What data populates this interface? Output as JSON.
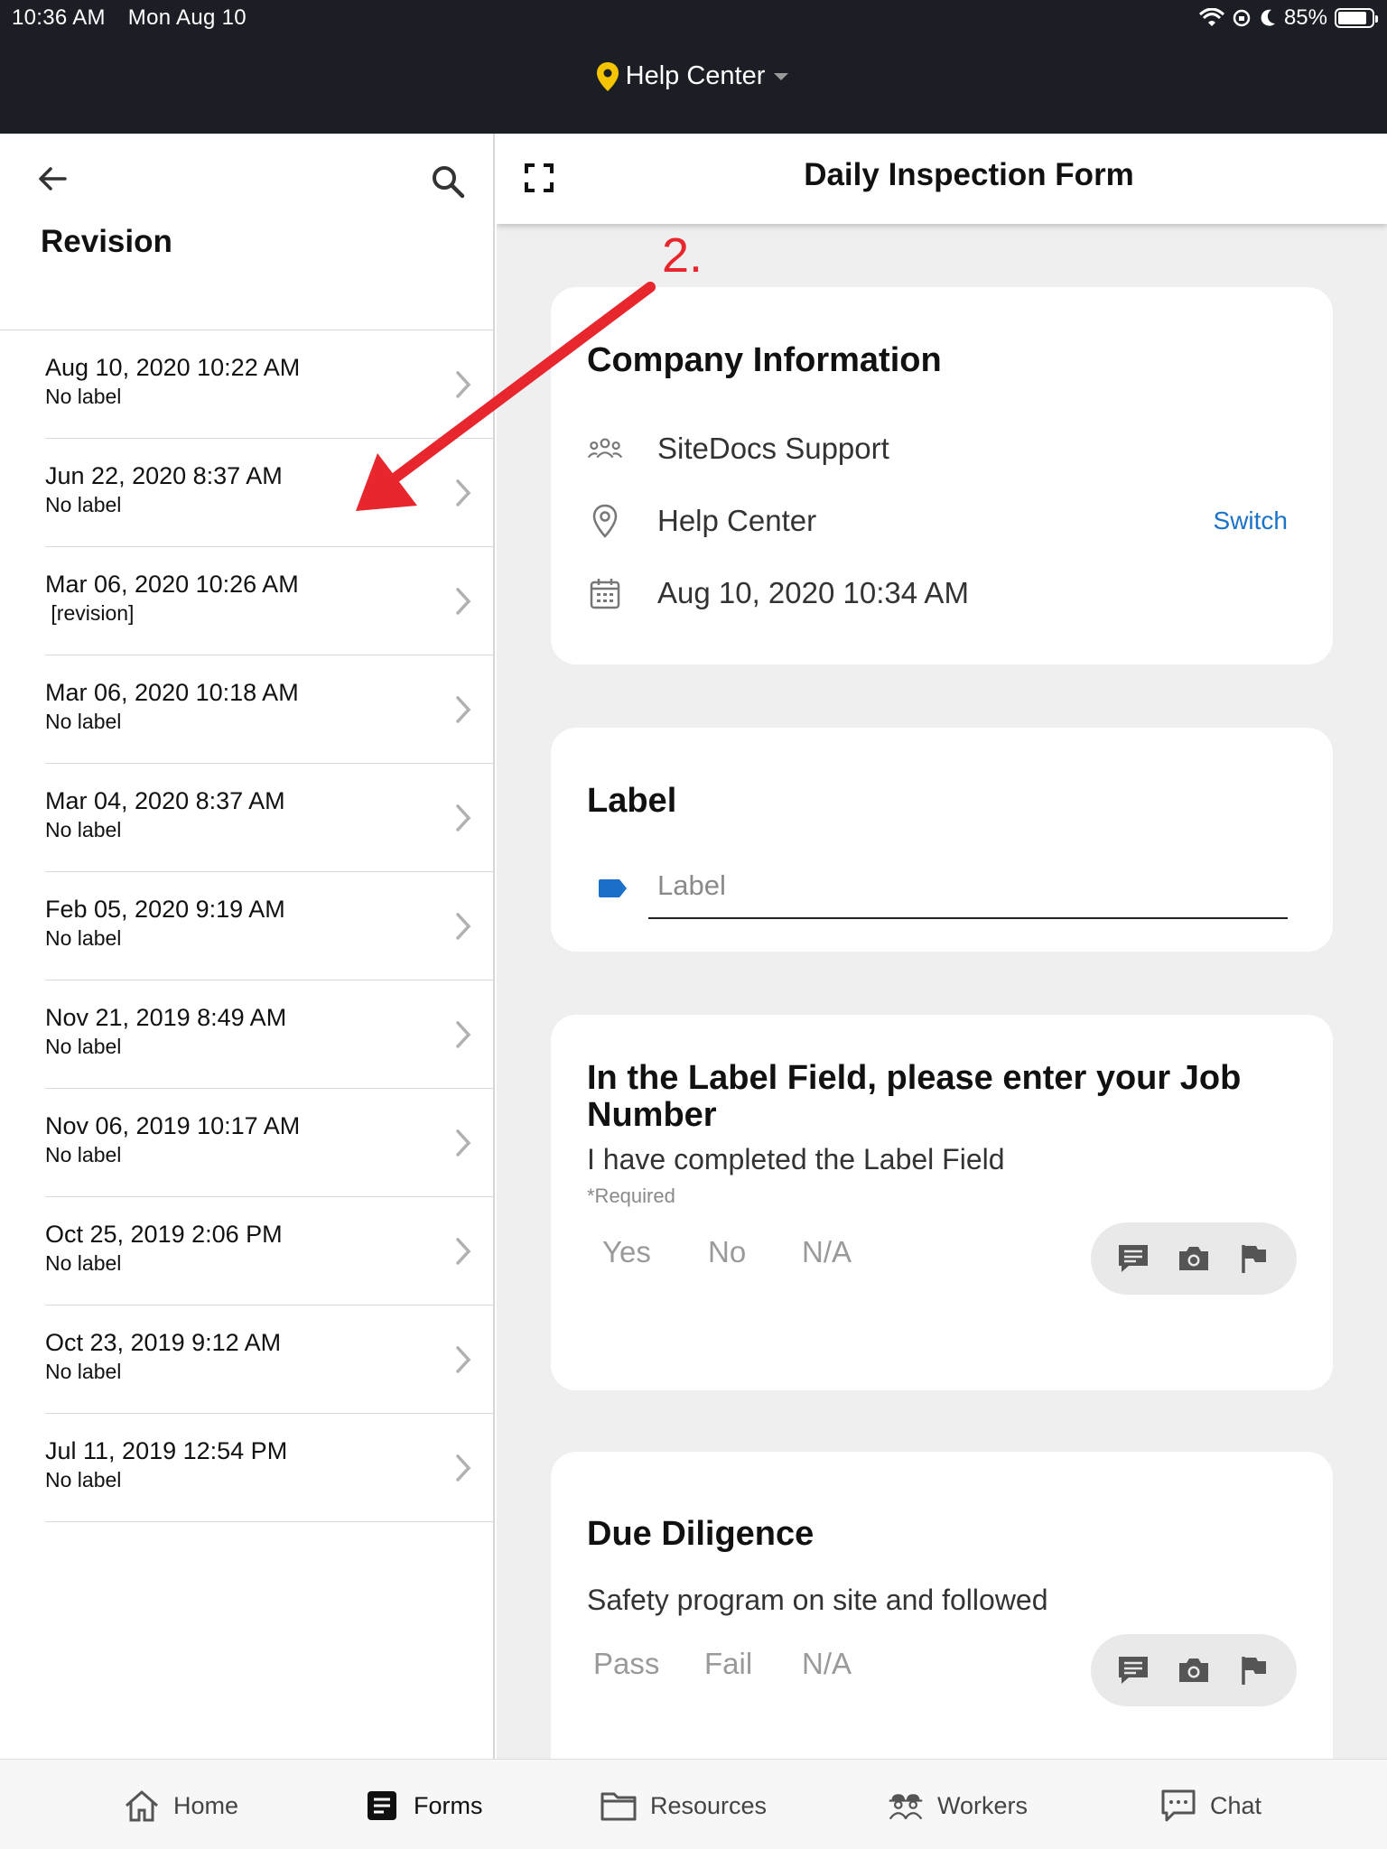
{
  "status_bar": {
    "time": "10:36 AM",
    "date": "Mon Aug 10",
    "battery": "85%",
    "battery_level": 0.85
  },
  "location_switcher": {
    "label": "Help Center",
    "icon": "location-pin-icon",
    "pin_color": "#f5c400"
  },
  "left_panel": {
    "title": "Revision",
    "revisions": [
      {
        "date": "Aug 10, 2020 10:22 AM",
        "label": "No label"
      },
      {
        "date": "Jun 22, 2020 8:37 AM",
        "label": "No label"
      },
      {
        "date": "Mar 06, 2020 10:26 AM",
        "label": " [revision]"
      },
      {
        "date": "Mar 06, 2020 10:18 AM",
        "label": "No label"
      },
      {
        "date": "Mar 04, 2020 8:37 AM",
        "label": "No label"
      },
      {
        "date": "Feb 05, 2020 9:19 AM",
        "label": "No label"
      },
      {
        "date": "Nov 21, 2019 8:49 AM",
        "label": "No label"
      },
      {
        "date": "Nov 06, 2019 10:17 AM",
        "label": "No label"
      },
      {
        "date": "Oct 25, 2019 2:06 PM",
        "label": "No label"
      },
      {
        "date": "Oct 23, 2019 9:12 AM",
        "label": "No label"
      },
      {
        "date": "Jul 11, 2019 12:54 PM",
        "label": "No label"
      }
    ]
  },
  "form": {
    "title": "Daily Inspection Form",
    "company_card": {
      "title": "Company Information",
      "company": "SiteDocs Support",
      "location": "Help Center",
      "switch_label": "Switch",
      "datetime": "Aug 10, 2020 10:34 AM"
    },
    "label_card": {
      "title": "Label",
      "placeholder": "Label",
      "value": ""
    },
    "question_card": {
      "title": "In the Label Field, please enter your Job Number",
      "description": "I have completed the Label Field",
      "required": "*Required",
      "choices": [
        "Yes",
        "No",
        "N/A"
      ]
    },
    "diligence_card": {
      "title": "Due Diligence",
      "description": "Safety program on site and followed",
      "choices": [
        "Pass",
        "Fail",
        "N/A"
      ]
    }
  },
  "annotation": {
    "number": "2.",
    "color": "#e8262d"
  },
  "bottom_nav": {
    "items": [
      {
        "label": "Home",
        "icon": "home-icon"
      },
      {
        "label": "Forms",
        "icon": "forms-icon"
      },
      {
        "label": "Resources",
        "icon": "folder-icon"
      },
      {
        "label": "Workers",
        "icon": "workers-icon"
      },
      {
        "label": "Chat",
        "icon": "chat-icon"
      }
    ],
    "active": "Forms"
  }
}
